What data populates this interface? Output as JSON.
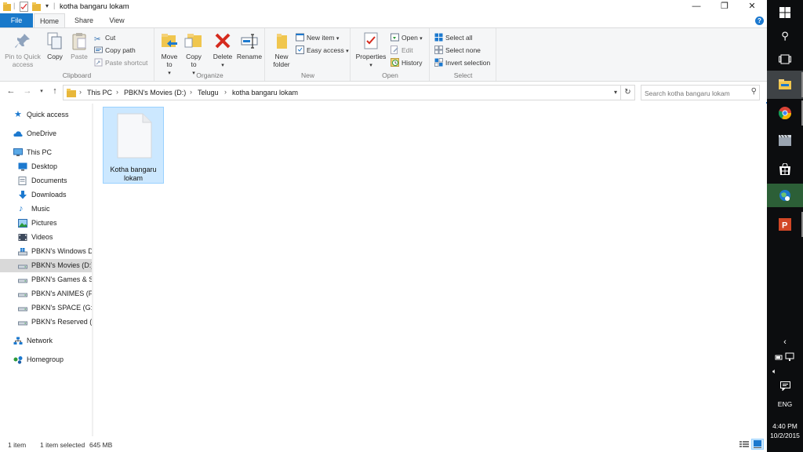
{
  "window": {
    "title": "kotha bangaru lokam",
    "controls": {
      "minimize": "—",
      "maximize": "❐",
      "close": "✕"
    }
  },
  "tabs": {
    "file": "File",
    "home": "Home",
    "share": "Share",
    "view": "View",
    "help": "?"
  },
  "ribbon": {
    "clipboard": {
      "label": "Clipboard",
      "pin": "Pin to Quick access",
      "copy": "Copy",
      "paste": "Paste",
      "cut": "Cut",
      "copy_path": "Copy path",
      "paste_shortcut": "Paste shortcut"
    },
    "organize": {
      "label": "Organize",
      "move_to": "Move to",
      "copy_to": "Copy to",
      "delete": "Delete",
      "rename": "Rename"
    },
    "new": {
      "label": "New",
      "new_folder": "New folder",
      "new_item": "New item",
      "easy_access": "Easy access"
    },
    "open": {
      "label": "Open",
      "properties": "Properties",
      "open": "Open",
      "edit": "Edit",
      "history": "History"
    },
    "select": {
      "label": "Select",
      "select_all": "Select all",
      "select_none": "Select none",
      "invert": "Invert selection"
    }
  },
  "address": {
    "crumbs": [
      "This PC",
      "PBKN's Movies (D:)",
      "Telugu",
      "kotha bangaru lokam"
    ],
    "search_placeholder": "Search kotha bangaru lokam"
  },
  "navpane": {
    "items": [
      {
        "label": "Quick access",
        "icon": "star-icon"
      },
      {
        "label": "OneDrive",
        "icon": "cloud-icon"
      },
      {
        "label": "This PC",
        "icon": "computer-icon"
      },
      {
        "label": "Desktop",
        "icon": "desktop-icon"
      },
      {
        "label": "Documents",
        "icon": "documents-icon"
      },
      {
        "label": "Downloads",
        "icon": "download-icon"
      },
      {
        "label": "Music",
        "icon": "music-icon"
      },
      {
        "label": "Pictures",
        "icon": "pictures-icon"
      },
      {
        "label": "Videos",
        "icon": "videos-icon"
      },
      {
        "label": "PBKN's Windows Dr",
        "icon": "drive-icon"
      },
      {
        "label": "PBKN's Movies (D:)",
        "icon": "drive-icon",
        "selected": true
      },
      {
        "label": "PBKN's Games & Sc",
        "icon": "drive-icon"
      },
      {
        "label": "PBKN's ANIMES (F:)",
        "icon": "drive-icon"
      },
      {
        "label": "PBKN's SPACE (G:)",
        "icon": "drive-icon"
      },
      {
        "label": "PBKN's Reserved (J:",
        "icon": "drive-icon"
      },
      {
        "label": "Network",
        "icon": "network-icon"
      },
      {
        "label": "Homegroup",
        "icon": "homegroup-icon"
      }
    ]
  },
  "content": {
    "files": [
      {
        "name": "Kotha bangaru lokam",
        "icon": "blank-file-icon",
        "selected": true
      }
    ]
  },
  "status": {
    "count": "1 item",
    "selected": "1 item selected",
    "size": "645 MB"
  },
  "taskbar": {
    "language": "ENG",
    "time": "4:40 PM",
    "date": "10/2/2015",
    "apps": [
      "windows-icon",
      "search-icon",
      "task-view-icon",
      "file-explorer-icon",
      "chrome-icon",
      "film-icon",
      "store-icon",
      "globe-app-icon",
      "powerpoint-icon"
    ]
  },
  "colors": {
    "accent": "#1979ca",
    "selection": "#cce8ff",
    "taskbar": "#0c0d0f"
  }
}
